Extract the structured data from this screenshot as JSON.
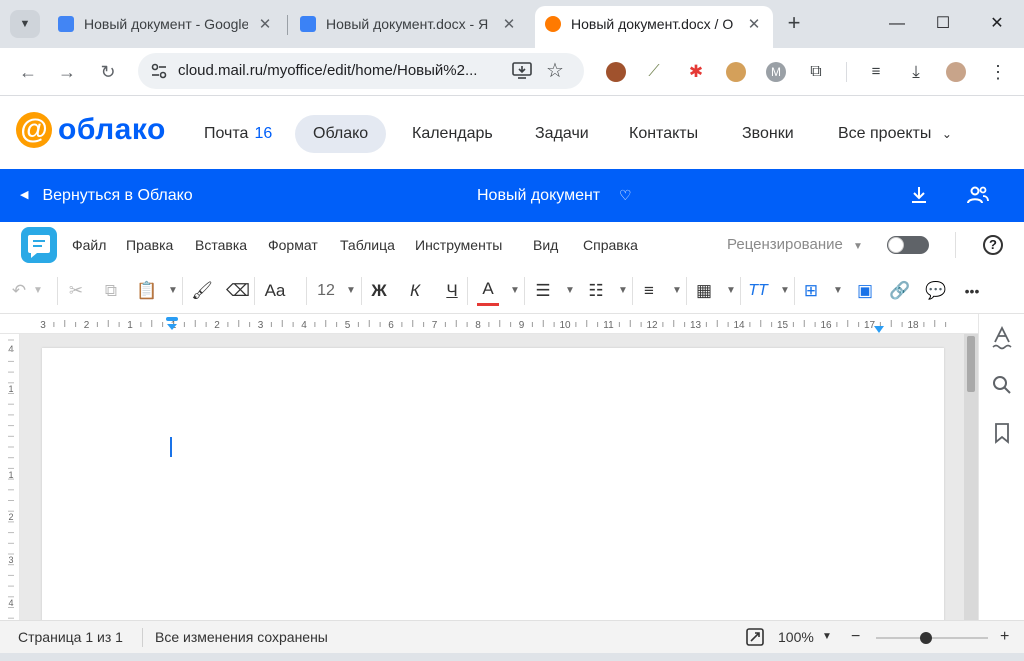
{
  "browser": {
    "tabs": [
      {
        "title": "Новый документ - Google",
        "favicon_color": "#4285f4",
        "active": false
      },
      {
        "title": "Новый документ.docx - Я",
        "favicon_color": "#3b82f6",
        "active": false
      },
      {
        "title": "Новый документ.docx / О",
        "favicon_color": "#ff7a00",
        "active": true
      }
    ],
    "new_tab": "+",
    "address": "cloud.mail.ru/myoffice/edit/home/Новый%2...",
    "profile_initial": "M"
  },
  "service_header": {
    "logo_symbol": "@",
    "logo_text": "облако",
    "nav": [
      {
        "label": "Почта",
        "count": "16"
      },
      {
        "label": "Облако",
        "active": true
      },
      {
        "label": "Календарь"
      },
      {
        "label": "Задачи"
      },
      {
        "label": "Контакты"
      },
      {
        "label": "Звонки"
      },
      {
        "label": "Все проекты"
      }
    ]
  },
  "doc_bar": {
    "back_label": "Вернуться в Облако",
    "title": "Новый документ"
  },
  "menu": {
    "items": [
      "Файл",
      "Правка",
      "Вставка",
      "Формат",
      "Таблица",
      "Инструменты",
      "Вид",
      "Справка"
    ],
    "review_label": "Рецензирование",
    "review_enabled": false,
    "help_symbol": "?"
  },
  "format_toolbar": {
    "font_style_label": "Aa",
    "font_size": "12",
    "bold": "Ж",
    "italic": "К",
    "underline": "Ч",
    "font_color_letter": "A",
    "font_color": "#e53935",
    "text_size_label": "TT",
    "more": "•••"
  },
  "ruler": {
    "numbers": [
      "3",
      "2",
      "1",
      "1",
      "2",
      "3",
      "4",
      "5",
      "6",
      "7",
      "8",
      "9",
      "10",
      "11",
      "12",
      "13",
      "14",
      "15",
      "16",
      "17",
      "18"
    ],
    "v_numbers": [
      "4",
      "1",
      "1",
      "2",
      "3",
      "4"
    ]
  },
  "status": {
    "page_info": "Страница 1 из 1",
    "save_status": "Все изменения сохранены",
    "zoom": "100%",
    "zoom_level": 0.45,
    "zoom_minus": "−",
    "zoom_plus": "+"
  }
}
